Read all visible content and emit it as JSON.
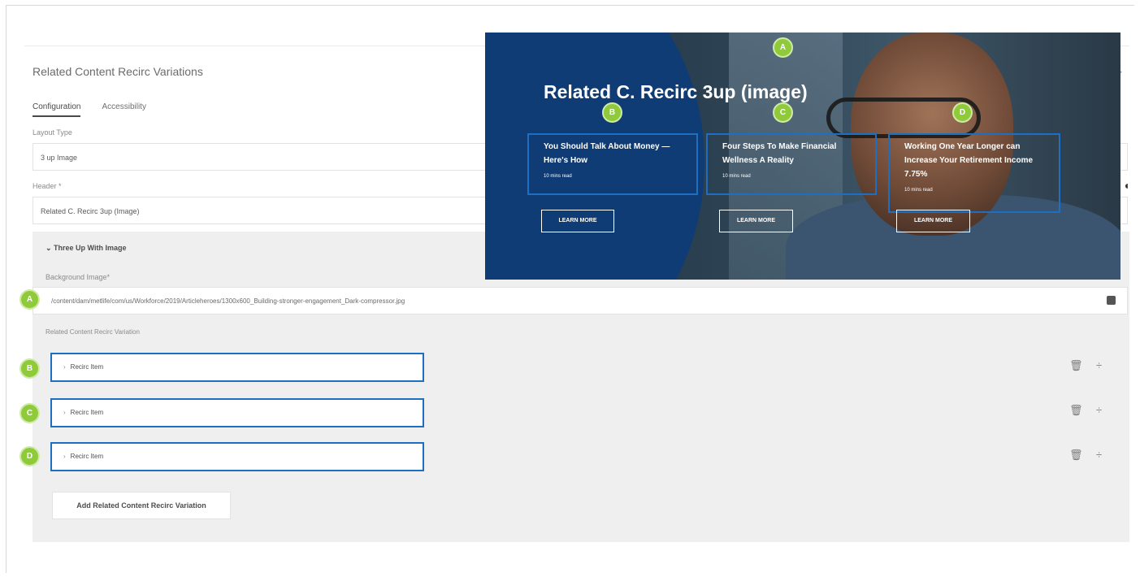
{
  "dialog": {
    "title": "Related Content Recirc Variations",
    "tabs": [
      {
        "label": "Configuration",
        "active": true
      },
      {
        "label": "Accessibility",
        "active": false
      }
    ]
  },
  "fields": {
    "layout_type_label": "Layout Type",
    "layout_type_value": "3 up Image",
    "header_label": "Header *",
    "header_value": "Related C. Recirc 3up (Image)"
  },
  "section": {
    "title": "Three Up With Image",
    "background_image_label": "Background Image*",
    "background_image_path": "/content/dam/metlife/com/us/Workforce/2019/Articleheroes/1300x600_Building-stronger-engagement_Dark-compressor.jpg",
    "variation_label": "Related Content Recirc Variation",
    "recirc_items": [
      {
        "label": "Recirc Item",
        "marker": "B"
      },
      {
        "label": "Recirc Item",
        "marker": "C"
      },
      {
        "label": "Recirc Item",
        "marker": "D"
      }
    ],
    "add_button_label": "Add Related Content Recirc Variation"
  },
  "preview": {
    "title": "Related C. Recirc 3up (image)",
    "cards": [
      {
        "title": "You Should Talk About Money — Here's How",
        "meta": "10 mins read",
        "button": "LEARN MORE",
        "marker": "B"
      },
      {
        "title": "Four Steps To Make Financial Wellness A Reality",
        "meta": "10 mins read",
        "button": "LEARN MORE",
        "marker": "C"
      },
      {
        "title": "Working One Year Longer can Increase Your Retirement Income 7.75%",
        "meta": "10 mins read",
        "button": "LEARN MORE",
        "marker": "D"
      }
    ]
  },
  "markers": {
    "a": "A",
    "b": "B",
    "c": "C",
    "d": "D"
  },
  "icons": {
    "delete": "trash-icon",
    "reorder": "drag-handle-icon",
    "browse": "folder-icon"
  },
  "colors": {
    "highlight_border": "#1e6fc2",
    "marker_fill": "#8fca3a",
    "preview_blue": "#0f3c75"
  }
}
